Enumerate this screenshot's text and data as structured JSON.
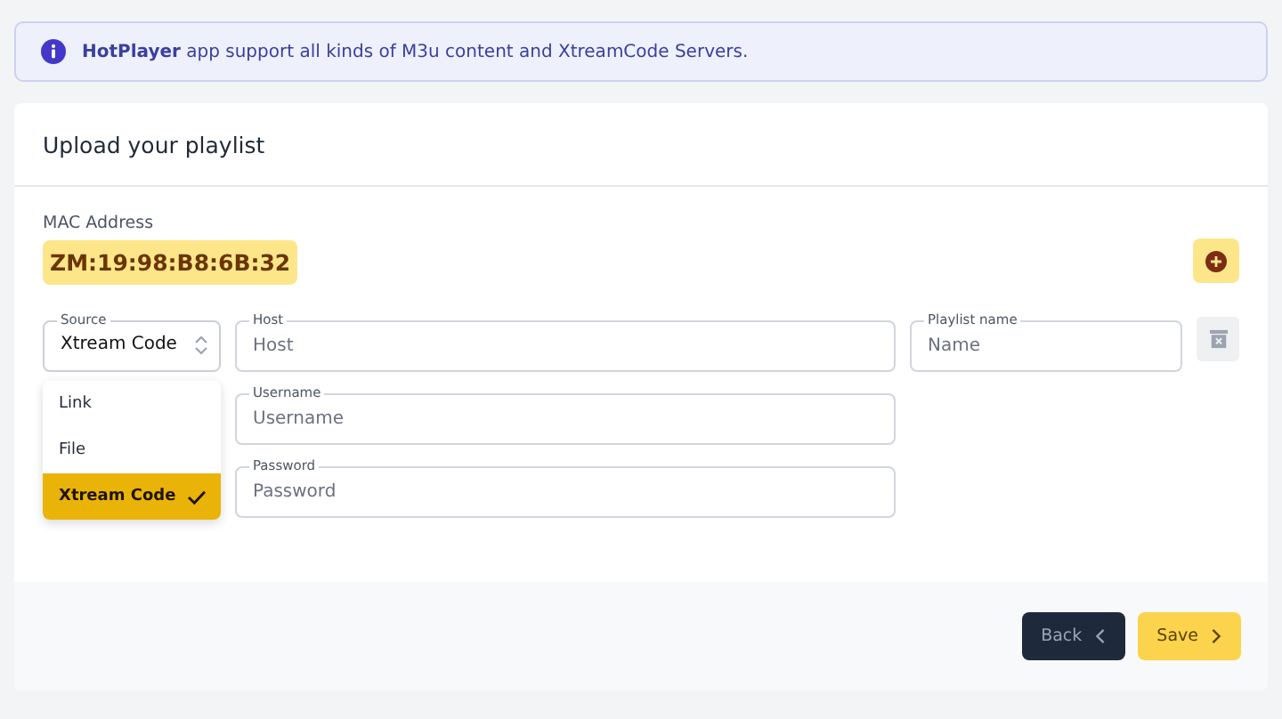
{
  "banner": {
    "text": "**HotPlayer** app support all kinds of M3u content and XtreamCode Servers."
  },
  "card": {
    "title": "Upload your playlist",
    "mac": {
      "label": "MAC Address",
      "value": "ZM:19:98:B8:6B:32"
    },
    "source": {
      "label": "Source",
      "value": "Xtream Code",
      "expanded": true,
      "options": [
        {
          "label": "Link",
          "selected": false
        },
        {
          "label": "File",
          "selected": false
        },
        {
          "label": "Xtream Code",
          "selected": true
        }
      ]
    },
    "fields": [
      {
        "label": "Host",
        "placeholder": "Host"
      },
      {
        "label": "Username",
        "placeholder": "Username"
      },
      {
        "label": "Password",
        "placeholder": "Password"
      }
    ],
    "playlist_name": {
      "label": "Playlist name",
      "placeholder": "Name"
    },
    "buttons": [
      {
        "label": "Back",
        "kind": "back"
      },
      {
        "label": "Save",
        "kind": "save"
      }
    ]
  }
}
